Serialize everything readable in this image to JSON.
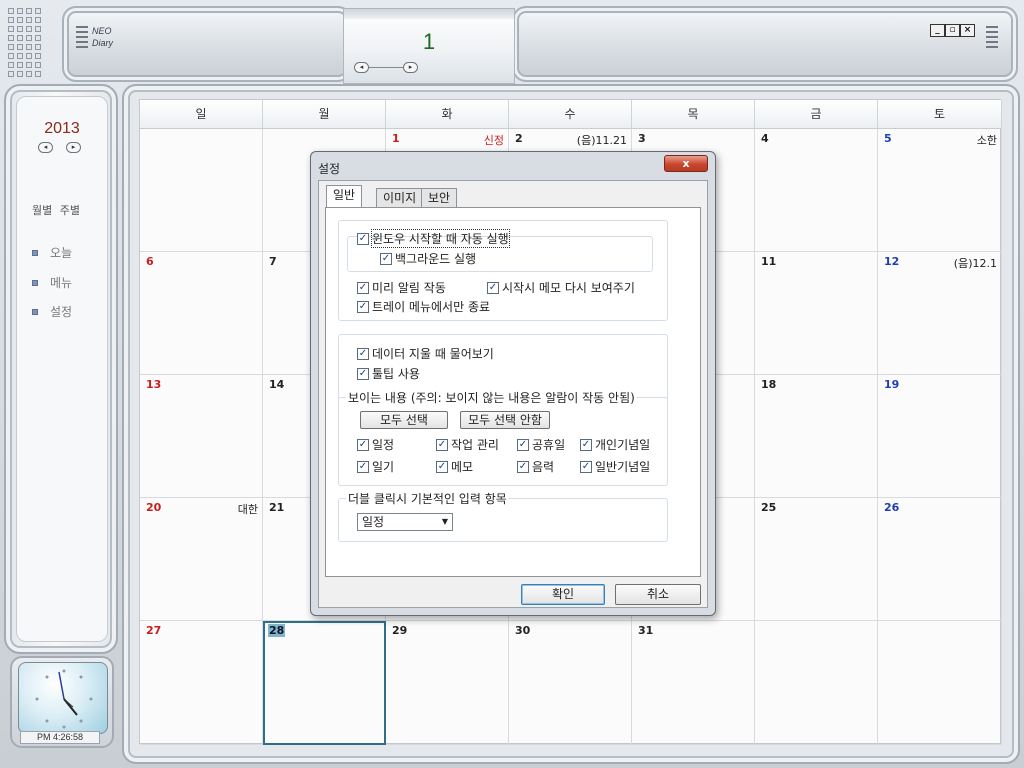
{
  "app": {
    "logo_line1": "NEO",
    "logo_line2": "Diary",
    "current_day": "1",
    "window_controls": [
      "_",
      "▫",
      "×"
    ]
  },
  "sidebar": {
    "year": "2013",
    "view_modes": "월별 주별",
    "menu": [
      {
        "label": "오늘",
        "icon": "square-bullet-icon"
      },
      {
        "label": "메뉴",
        "icon": "square-bullet-icon"
      },
      {
        "label": "설정",
        "icon": "square-bullet-icon"
      }
    ],
    "clock_time": "PM  4:26:58"
  },
  "calendar": {
    "weekdays": [
      "일",
      "월",
      "화",
      "수",
      "목",
      "금",
      "토"
    ],
    "weeks": [
      [
        {
          "day": "",
          "label": "",
          "color": "black"
        },
        {
          "day": "",
          "label": "",
          "color": "black"
        },
        {
          "day": "1",
          "label": "신정",
          "color": "red",
          "label_color": "red"
        },
        {
          "day": "2",
          "label": "(음)11.21",
          "color": "black"
        },
        {
          "day": "3",
          "label": "",
          "color": "black"
        },
        {
          "day": "4",
          "label": "",
          "color": "black"
        },
        {
          "day": "5",
          "label": "소한",
          "color": "blue"
        }
      ],
      [
        {
          "day": "6",
          "label": "",
          "color": "red"
        },
        {
          "day": "7",
          "label": "",
          "color": "black"
        },
        {
          "day": "",
          "label": "",
          "color": "black"
        },
        {
          "day": "",
          "label": "",
          "color": "black"
        },
        {
          "day": "",
          "label": "",
          "color": "black"
        },
        {
          "day": "11",
          "label": "",
          "color": "black"
        },
        {
          "day": "12",
          "label": "(음)12.1",
          "color": "blue"
        }
      ],
      [
        {
          "day": "13",
          "label": "",
          "color": "red"
        },
        {
          "day": "14",
          "label": "",
          "color": "black"
        },
        {
          "day": "",
          "label": "",
          "color": "black"
        },
        {
          "day": "",
          "label": "",
          "color": "black"
        },
        {
          "day": "",
          "label": "",
          "color": "black"
        },
        {
          "day": "18",
          "label": "",
          "color": "black"
        },
        {
          "day": "19",
          "label": "",
          "color": "blue"
        }
      ],
      [
        {
          "day": "20",
          "label": "대한",
          "color": "red"
        },
        {
          "day": "21",
          "label": "",
          "color": "black"
        },
        {
          "day": "",
          "label": "",
          "color": "black"
        },
        {
          "day": "",
          "label": "",
          "color": "black"
        },
        {
          "day": "",
          "label": "",
          "color": "black"
        },
        {
          "day": "25",
          "label": "",
          "color": "black"
        },
        {
          "day": "26",
          "label": "",
          "color": "blue"
        }
      ],
      [
        {
          "day": "27",
          "label": "",
          "color": "red"
        },
        {
          "day": "28",
          "label": "",
          "color": "black",
          "today": true
        },
        {
          "day": "29",
          "label": "",
          "color": "black"
        },
        {
          "day": "30",
          "label": "",
          "color": "black"
        },
        {
          "day": "31",
          "label": "",
          "color": "black"
        },
        {
          "day": "",
          "label": "",
          "color": "black"
        },
        {
          "day": "",
          "label": "",
          "color": "black"
        }
      ]
    ]
  },
  "dialog": {
    "title": "설정",
    "close": "x",
    "tabs": [
      "일반",
      "이미지",
      "보안"
    ],
    "active_tab": "일반",
    "options": {
      "autostart": {
        "label": "윈도우 시작할 때 자동 실행",
        "checked": true
      },
      "background": {
        "label": "백그라운드 실행",
        "checked": true
      },
      "pre_alarm": {
        "label": "미리 알림 작동",
        "checked": true
      },
      "show_memo": {
        "label": "시작시 메모 다시 보여주기",
        "checked": true
      },
      "tray_exit": {
        "label": "트레이 메뉴에서만 종료",
        "checked": true
      },
      "ask_delete": {
        "label": "데이터 지울 때 물어보기",
        "checked": true
      },
      "tooltip": {
        "label": "툴팁 사용",
        "checked": true
      }
    },
    "visible_group": {
      "label": "보이는 내용 (주의: 보이지 않는 내용은 알람이 작동 안됨)",
      "select_all": "모두 선택",
      "deselect_all": "모두 선택 안함",
      "items": [
        {
          "label": "일정",
          "checked": true
        },
        {
          "label": "작업 관리",
          "checked": true
        },
        {
          "label": "공휴일",
          "checked": true
        },
        {
          "label": "개인기념일",
          "checked": true
        },
        {
          "label": "일기",
          "checked": true
        },
        {
          "label": "메모",
          "checked": true
        },
        {
          "label": "음력",
          "checked": true
        },
        {
          "label": "일반기념일",
          "checked": true
        }
      ]
    },
    "dblclick_group": {
      "label": "더블 클릭시 기본적인 입력 항목",
      "selected": "일정"
    },
    "ok": "확인",
    "cancel": "취소"
  },
  "colors": {
    "sunday": "#c81e1e",
    "saturday": "#1f3fb0",
    "today_border": "#2f6f8a",
    "day_number_green": "#1d6a22",
    "year_color": "#8a2b1c"
  }
}
